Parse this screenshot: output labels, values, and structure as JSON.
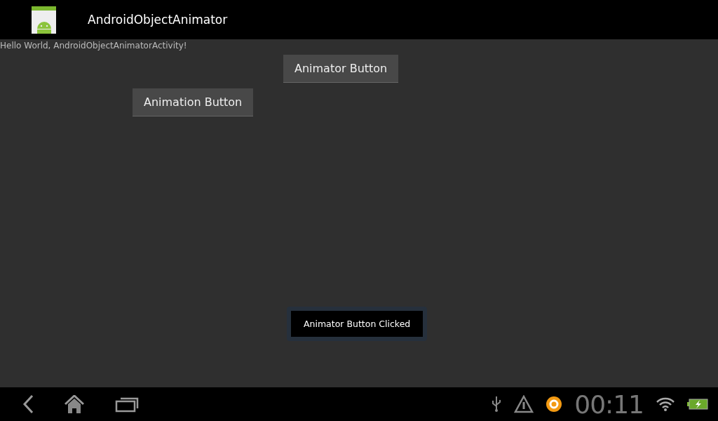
{
  "action_bar": {
    "title": "AndroidObjectAnimator"
  },
  "content": {
    "hello_text": "Hello World, AndroidObjectAnimatorActivity!",
    "buttons": [
      "Animator Button",
      "Animation Button"
    ]
  },
  "toast": {
    "text": "Animator Button Clicked"
  },
  "system_bar": {
    "time": "00:11"
  }
}
